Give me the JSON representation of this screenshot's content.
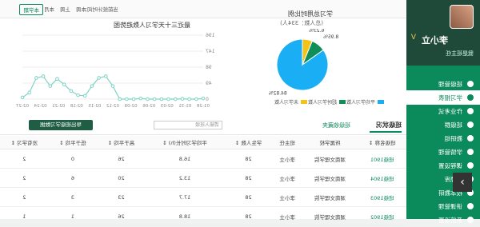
{
  "profile": {
    "name": "李小立",
    "badge": "V",
    "subtitle": "我是班主任"
  },
  "nav": [
    "班级管理",
    "学习报表",
    "作业考试",
    "班级群",
    "教研组",
    "学情管理",
    "课程设置",
    "资源库",
    "校本教研",
    "讲课管理",
    "系统设置"
  ],
  "nav_active_index": 1,
  "top_bar": {
    "label": "当前统计时间：",
    "opts": [
      "本周",
      "上周",
      "本月"
    ],
    "semester_button": "本学期"
  },
  "pie_chart": {
    "title": "学习总用时比例",
    "subtitle": "(总人数：334人)",
    "chart_data": {
      "type": "pie",
      "slices": [
        {
          "label": "平均学习人数",
          "value": 84.82,
          "display": "84.82%",
          "color": "#1aaef5"
        },
        {
          "label": "超时学习人数",
          "value": 8.95,
          "display": "8.95%",
          "color": "#0f8f57"
        },
        {
          "label": "未学习人数",
          "value": 6.23,
          "display": "6.23%",
          "color": "#f5c219"
        }
      ]
    }
  },
  "line_chart": {
    "title": "最近三十天学习人数趋势图",
    "chart_data": {
      "type": "line",
      "x": [
        "01-28",
        "01-31",
        "02-03",
        "02-06",
        "02-09",
        "02-12",
        "02-15",
        "02-18",
        "02-21",
        "02-24",
        "02-27"
      ],
      "y_ticks": [
        0,
        49,
        98,
        147,
        196
      ],
      "ylim": [
        0,
        196
      ],
      "values": [
        2,
        0,
        0,
        1,
        0,
        0,
        0,
        0,
        0,
        2,
        0,
        0,
        0,
        40,
        70,
        65,
        40,
        10,
        12,
        25,
        45,
        62,
        40,
        70,
        65,
        20,
        5
      ],
      "color": "#7fd3c6"
    }
  },
  "table_section": {
    "tab_label": "班级状况",
    "fav_label": "班级收藏夹",
    "search_placeholder": "请输入班级",
    "export_label": "导出班级学习数据",
    "columns": [
      "班级名称 ↕",
      "所属学校",
      "班主任",
      "学生人数 ↕",
      "平均学习时长(h) ↕",
      "高于平均 ↕",
      "低于平均 ↕",
      "没有学习 ↕"
    ],
    "rows": [
      [
        "班级1901",
        "湖南文理学院",
        "李小立",
        "28",
        "16.8",
        "26",
        "0",
        "2"
      ],
      [
        "班级1904",
        "湖南文理学院",
        "李小立",
        "28",
        "13.2",
        "20",
        "6",
        "2"
      ],
      [
        "班级1903",
        "湖南文理学院",
        "李小立",
        "28",
        "17.7",
        "23",
        "3",
        "2"
      ],
      [
        "班级1902",
        "湖南文理学院",
        "李小立",
        "28",
        "18.8",
        "26",
        "1",
        "1"
      ]
    ]
  }
}
